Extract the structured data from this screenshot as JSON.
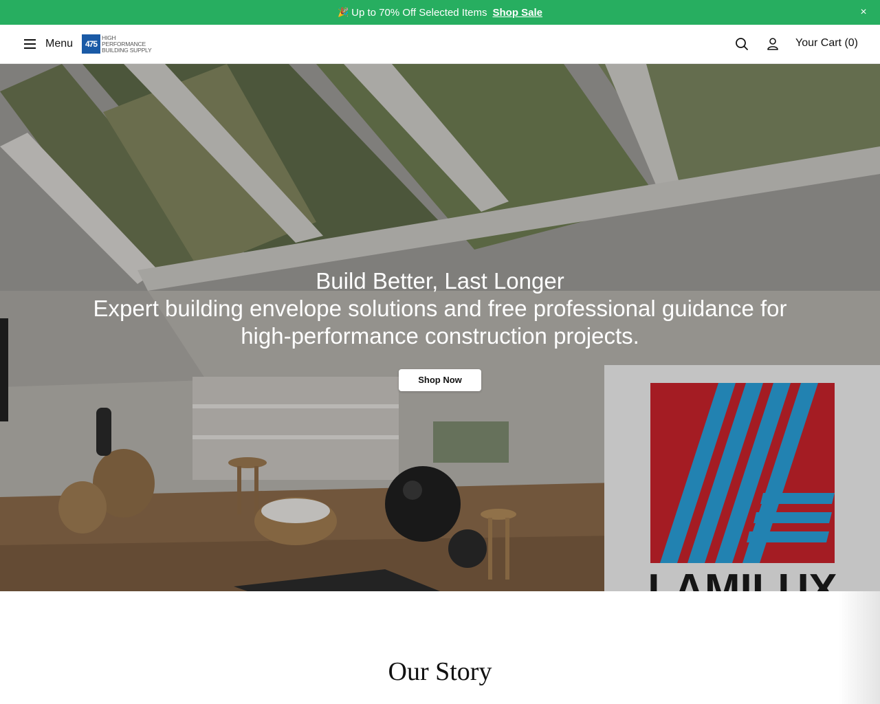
{
  "announcement": {
    "emoji": "🎉",
    "text": "Up to 70% Off Selected Items",
    "link_label": "Shop Sale",
    "close_label": "×",
    "bg_color": "#27ae60"
  },
  "header": {
    "menu_label": "Menu",
    "logo": {
      "mark": "475",
      "lines": [
        "HIGH",
        "PERFORMANCE",
        "BUILDING SUPPLY"
      ],
      "brand_color": "#1a5aa6"
    },
    "cart_label": "Your Cart (0)",
    "icons": [
      "menu-icon",
      "search-icon",
      "account-icon"
    ]
  },
  "hero": {
    "title": "Build Better, Last Longer",
    "subtitle": "Expert building envelope solutions and free professional guidance for high-performance construction projects.",
    "button_label": "Shop Now",
    "badge_text": "LAMILUX"
  },
  "story": {
    "title": "Our Story"
  }
}
